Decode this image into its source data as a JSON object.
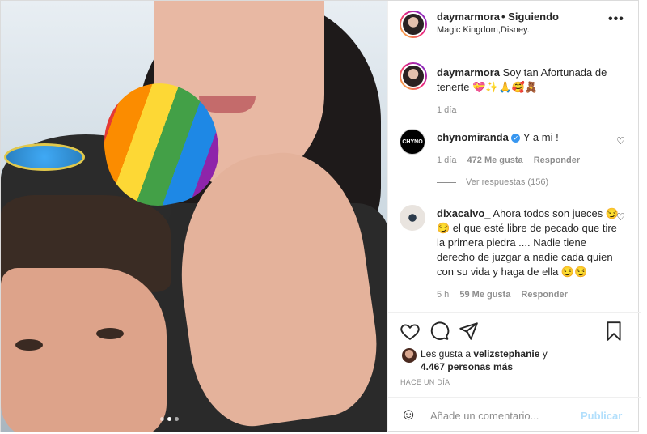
{
  "header": {
    "username": "daymarmora",
    "follow_status": "• Siguiendo",
    "location": "Magic Kingdom,Disney.",
    "more_icon": "more-horizontal-icon"
  },
  "caption": {
    "username": "daymarmora",
    "text": "Soy tan Afortunada de tenerte 💝✨🙏🥰🧸",
    "time": "1 día"
  },
  "comments": [
    {
      "username": "chynomiranda",
      "avatar_text": "CHYNO",
      "verified": true,
      "text": "Y a mi !",
      "time": "1 día",
      "likes": "472 Me gusta",
      "reply": "Responder",
      "view_replies": "Ver respuestas (156)"
    },
    {
      "username": "dixacalvo_",
      "text": "Ahora todos son jueces 😏😏 el que esté libre de pecado que tire la primera piedra .... Nadie tiene derecho de juzgar a nadie cada quien con su vida y haga de ella 😏😏",
      "time": "5 h",
      "likes": "59 Me gusta",
      "reply": "Responder"
    }
  ],
  "likes": {
    "prefix": "Les gusta a",
    "user": "velizstephanie",
    "suffix": "y",
    "count": "4.467 personas más"
  },
  "timeago": "HACE UN DÍA",
  "add_comment": {
    "placeholder": "Añade un comentario...",
    "publish": "Publicar"
  },
  "carousel": {
    "total": 3,
    "active": 2
  }
}
